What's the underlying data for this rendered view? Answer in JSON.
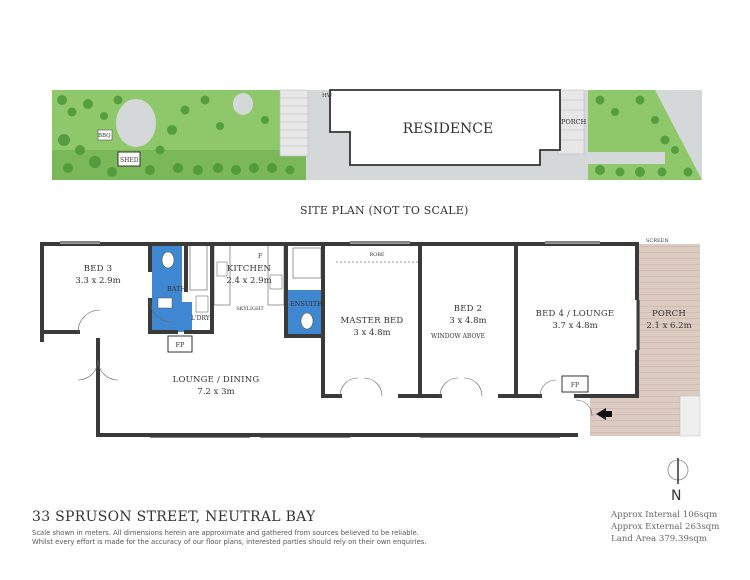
{
  "site_plan": {
    "caption": "SITE PLAN (NOT TO SCALE)",
    "residence_label": "RESIDENCE",
    "porch_label": "PORCH",
    "bbq_label": "BBQ",
    "shed_label": "SHED",
    "hw_label": "HW"
  },
  "floor_plan": {
    "rooms": {
      "bed3": {
        "name": "BED 3",
        "size": "3.3 x 2.9m"
      },
      "bath": {
        "name": "BATH"
      },
      "ldry": {
        "name": "L'DRY"
      },
      "kitchen": {
        "name": "KITCHEN",
        "size": "2.4 x 2.9m"
      },
      "ensuite": {
        "name": "ENSUITE"
      },
      "master": {
        "name": "MASTER BED",
        "size": "3 x 4.8m"
      },
      "bed2": {
        "name": "BED 2",
        "size": "3 x 4.8m"
      },
      "bed4": {
        "name": "BED 4 / LOUNGE",
        "size": "3.7 x 4.8m"
      },
      "porch": {
        "name": "PORCH",
        "size": "2.1 x 6.2m"
      },
      "lounge": {
        "name": "LOUNGE / DINING",
        "size": "7.2 x 3m"
      }
    },
    "labels": {
      "fp1": "FP",
      "fp2": "FP",
      "window_above": "WINDOW ABOVE",
      "robe": "ROBE",
      "skylight": "SKYLIGHT",
      "screen": "SCREEN",
      "fridge": "F"
    }
  },
  "north": {
    "letter": "N"
  },
  "footer": {
    "address": "33 SPRUSON STREET, NEUTRAL BAY",
    "disclaimer_1": "Scale shown in meters. All dimensions herein are approximate and gathered from sources believed to be  reliable.",
    "disclaimer_2": "Whilst every effort is made for the accuracy of our floor plans, interested parties should rely on their own enquiries.",
    "internal": "Approx Internal 106sqm",
    "external": "Approx External 263sqm",
    "land": "Land Area 379.39sqm"
  },
  "colors": {
    "lawn": "#8fc86a",
    "tree_dark": "#4f9a3c",
    "paving": "#cfd2d3",
    "porch_deck": "#d9c8bd",
    "wet_area": "#3f87d0",
    "wall": "#3a3a3a"
  }
}
